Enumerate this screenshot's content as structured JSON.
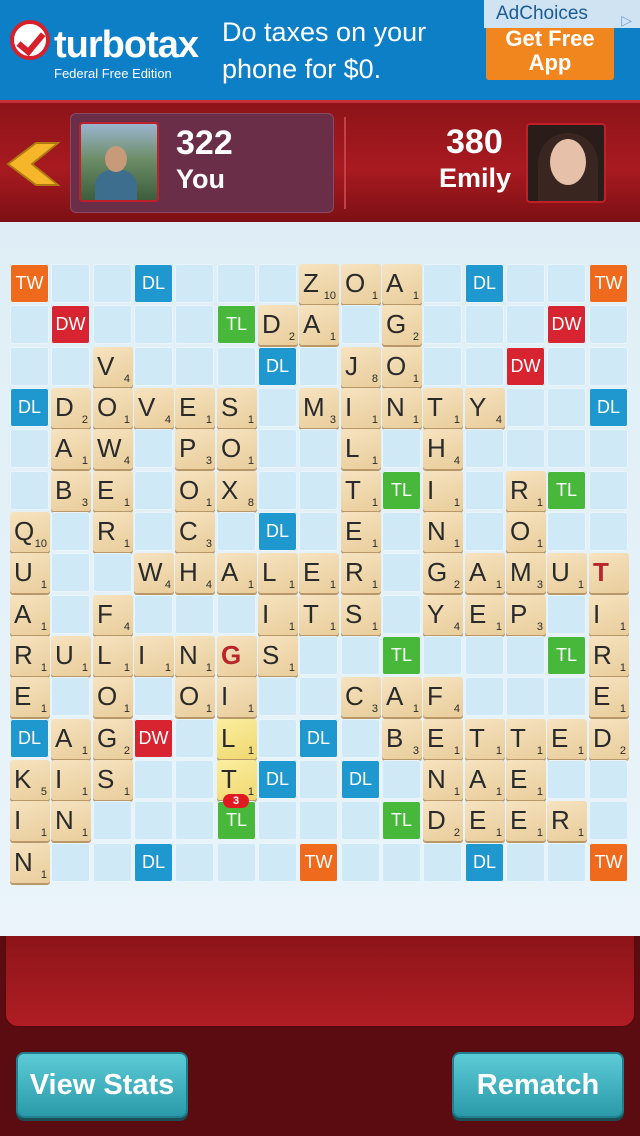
{
  "ad": {
    "brand": "turbotax",
    "subtitle": "Federal Free Edition",
    "text": "Do taxes on your phone for $0.",
    "cta": "Get Free App",
    "adchoices": "AdChoices",
    "colors": {
      "background": "#0d7fc7",
      "cta": "#f2861e"
    }
  },
  "header": {
    "back_icon": "back-arrow-icon",
    "player": {
      "score": "322",
      "name": "You"
    },
    "opponent": {
      "score": "380",
      "name": "Emily"
    }
  },
  "board": {
    "size": 15,
    "premium_labels": {
      "tw": "TW",
      "dw": "DW",
      "tl": "TL",
      "dl": "DL"
    },
    "premium_squares": [
      [
        "tw",
        0,
        0
      ],
      [
        "dl",
        0,
        3
      ],
      [
        "dl",
        0,
        11
      ],
      [
        "tw",
        0,
        14
      ],
      [
        "dw",
        1,
        1
      ],
      [
        "tl",
        1,
        5
      ],
      [
        "dw",
        1,
        13
      ],
      [
        "dl",
        2,
        6
      ],
      [
        "dw",
        2,
        12
      ],
      [
        "dl",
        3,
        0
      ],
      [
        "dl",
        3,
        14
      ],
      [
        "tl",
        5,
        9
      ],
      [
        "tl",
        5,
        13
      ],
      [
        "dl",
        6,
        6
      ],
      [
        "tl",
        9,
        9
      ],
      [
        "tl",
        9,
        13
      ],
      [
        "dl",
        11,
        0
      ],
      [
        "dw",
        11,
        3
      ],
      [
        "dl",
        11,
        7
      ],
      [
        "dl",
        12,
        6
      ],
      [
        "dl",
        12,
        8
      ],
      [
        "tl",
        13,
        5
      ],
      [
        "tl",
        13,
        9
      ],
      [
        "dl",
        14,
        3
      ],
      [
        "tw",
        14,
        7
      ],
      [
        "dl",
        14,
        11
      ],
      [
        "tw",
        14,
        14
      ]
    ],
    "tiles": [
      [
        0,
        7,
        "Z",
        "10"
      ],
      [
        0,
        8,
        "O",
        "1"
      ],
      [
        0,
        9,
        "A",
        "1"
      ],
      [
        1,
        6,
        "D",
        "2"
      ],
      [
        1,
        7,
        "A",
        "1"
      ],
      [
        1,
        9,
        "G",
        "2"
      ],
      [
        2,
        2,
        "V",
        "4"
      ],
      [
        2,
        8,
        "J",
        "8"
      ],
      [
        2,
        9,
        "O",
        "1"
      ],
      [
        3,
        1,
        "D",
        "2"
      ],
      [
        3,
        2,
        "O",
        "1"
      ],
      [
        3,
        3,
        "V",
        "4"
      ],
      [
        3,
        4,
        "E",
        "1"
      ],
      [
        3,
        5,
        "S",
        "1"
      ],
      [
        3,
        7,
        "M",
        "3"
      ],
      [
        3,
        8,
        "I",
        "1"
      ],
      [
        3,
        9,
        "N",
        "1"
      ],
      [
        3,
        10,
        "T",
        "1"
      ],
      [
        3,
        11,
        "Y",
        "4"
      ],
      [
        4,
        1,
        "A",
        "1"
      ],
      [
        4,
        2,
        "W",
        "4"
      ],
      [
        4,
        4,
        "P",
        "3"
      ],
      [
        4,
        5,
        "O",
        "1"
      ],
      [
        4,
        8,
        "L",
        "1"
      ],
      [
        4,
        10,
        "H",
        "4"
      ],
      [
        5,
        1,
        "B",
        "3"
      ],
      [
        5,
        2,
        "E",
        "1"
      ],
      [
        5,
        4,
        "O",
        "1"
      ],
      [
        5,
        5,
        "X",
        "8"
      ],
      [
        5,
        8,
        "T",
        "1"
      ],
      [
        5,
        10,
        "I",
        "1"
      ],
      [
        5,
        12,
        "R",
        "1"
      ],
      [
        6,
        0,
        "Q",
        "10"
      ],
      [
        6,
        2,
        "R",
        "1"
      ],
      [
        6,
        4,
        "C",
        "3"
      ],
      [
        6,
        8,
        "E",
        "1"
      ],
      [
        6,
        10,
        "N",
        "1"
      ],
      [
        6,
        12,
        "O",
        "1"
      ],
      [
        7,
        0,
        "U",
        "1"
      ],
      [
        7,
        3,
        "W",
        "4"
      ],
      [
        7,
        4,
        "H",
        "4"
      ],
      [
        7,
        5,
        "A",
        "1"
      ],
      [
        7,
        6,
        "L",
        "1"
      ],
      [
        7,
        7,
        "E",
        "1"
      ],
      [
        7,
        8,
        "R",
        "1"
      ],
      [
        7,
        10,
        "G",
        "2"
      ],
      [
        7,
        11,
        "A",
        "1"
      ],
      [
        7,
        12,
        "M",
        "3"
      ],
      [
        7,
        13,
        "U",
        "1"
      ],
      [
        7,
        14,
        "T",
        ""
      ],
      [
        8,
        0,
        "A",
        "1"
      ],
      [
        8,
        2,
        "F",
        "4"
      ],
      [
        8,
        6,
        "I",
        "1"
      ],
      [
        8,
        7,
        "T",
        "1"
      ],
      [
        8,
        8,
        "S",
        "1"
      ],
      [
        8,
        10,
        "Y",
        "4"
      ],
      [
        8,
        11,
        "E",
        "1"
      ],
      [
        8,
        12,
        "P",
        "3"
      ],
      [
        8,
        14,
        "I",
        "1"
      ],
      [
        9,
        0,
        "R",
        "1"
      ],
      [
        9,
        1,
        "U",
        "1"
      ],
      [
        9,
        2,
        "L",
        "1"
      ],
      [
        9,
        3,
        "I",
        "1"
      ],
      [
        9,
        4,
        "N",
        "1"
      ],
      [
        9,
        5,
        "G",
        ""
      ],
      [
        9,
        6,
        "S",
        "1"
      ],
      [
        9,
        14,
        "R",
        "1"
      ],
      [
        10,
        0,
        "E",
        "1"
      ],
      [
        10,
        2,
        "O",
        "1"
      ],
      [
        10,
        4,
        "O",
        "1"
      ],
      [
        10,
        5,
        "I",
        "1"
      ],
      [
        10,
        8,
        "C",
        "3"
      ],
      [
        10,
        9,
        "A",
        "1"
      ],
      [
        10,
        10,
        "F",
        "4"
      ],
      [
        10,
        14,
        "E",
        "1"
      ],
      [
        11,
        1,
        "A",
        "1"
      ],
      [
        11,
        2,
        "G",
        "2"
      ],
      [
        11,
        5,
        "L",
        "1"
      ],
      [
        11,
        9,
        "B",
        "3"
      ],
      [
        11,
        10,
        "E",
        "1"
      ],
      [
        11,
        11,
        "T",
        "1"
      ],
      [
        11,
        12,
        "T",
        "1"
      ],
      [
        11,
        13,
        "E",
        "1"
      ],
      [
        11,
        14,
        "D",
        "2"
      ],
      [
        12,
        0,
        "K",
        "5"
      ],
      [
        12,
        1,
        "I",
        "1"
      ],
      [
        12,
        2,
        "S",
        "1"
      ],
      [
        12,
        5,
        "T",
        "1"
      ],
      [
        12,
        10,
        "N",
        "1"
      ],
      [
        12,
        11,
        "A",
        "1"
      ],
      [
        12,
        12,
        "E",
        "1"
      ],
      [
        13,
        0,
        "I",
        "1"
      ],
      [
        13,
        1,
        "N",
        "1"
      ],
      [
        13,
        10,
        "D",
        "2"
      ],
      [
        13,
        11,
        "E",
        "1"
      ],
      [
        13,
        12,
        "E",
        "1"
      ],
      [
        13,
        13,
        "R",
        "1"
      ],
      [
        14,
        0,
        "N",
        "1"
      ]
    ],
    "recent_tiles": [
      [
        11,
        5
      ],
      [
        12,
        5
      ]
    ],
    "last_move_score": "3"
  },
  "buttons": {
    "view_stats": "View Stats",
    "rematch": "Rematch"
  },
  "colors": {
    "header": "#a81a20",
    "board_bg": "#e3f0f7",
    "button": "#3db3c1",
    "blank_letter": "#b8252a"
  }
}
